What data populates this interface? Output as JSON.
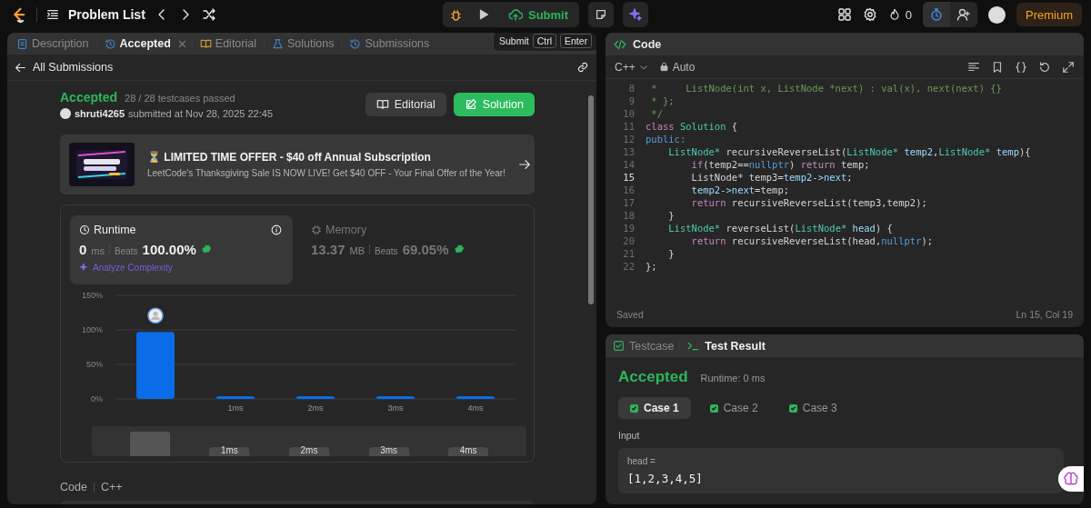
{
  "topbar": {
    "title": "Problem List",
    "submit": "Submit",
    "streak": "0",
    "premium": "Premium"
  },
  "tooltip": {
    "label": "Submit",
    "keys": [
      "Ctrl",
      "Enter"
    ]
  },
  "left_tabs": [
    {
      "label": "Description",
      "kind": "doc",
      "selected": false,
      "closable": false
    },
    {
      "label": "Accepted",
      "kind": "history",
      "selected": true,
      "closable": true
    },
    {
      "label": "Editorial",
      "kind": "book",
      "selected": false,
      "closable": false
    },
    {
      "label": "Solutions",
      "kind": "flask",
      "selected": false,
      "closable": false
    },
    {
      "label": "Submissions",
      "kind": "history",
      "selected": false,
      "closable": false
    }
  ],
  "back_link": "All Submissions",
  "submission": {
    "status": "Accepted",
    "testcases": "28 / 28 testcases passed",
    "user": "shruti4265",
    "submitted": "submitted at Nov 28, 2025 22:45",
    "editorial": "Editorial",
    "solution": "Solution"
  },
  "promo": {
    "kind": "picture",
    "title": "⏳ LIMITED TIME OFFER - $40 off Annual Subscription",
    "subtitle": "LeetCode's Thanksgiving Sale IS NOW LIVE! Get $40 OFF - Your Final Offer of the Year!"
  },
  "metrics": [
    {
      "label": "Runtime",
      "kind": "clock",
      "value": "0",
      "unit": "ms",
      "beats_label": "Beats",
      "beats": "100.00%",
      "selected": true
    },
    {
      "label": "Memory",
      "kind": "chip",
      "value": "13.37",
      "unit": "MB",
      "beats_label": "Beats",
      "beats": "69.05%",
      "selected": false
    }
  ],
  "analyze": "Analyze Complexity",
  "chart_data": {
    "type": "bar",
    "categories": [
      null,
      "1ms",
      "2ms",
      "3ms",
      "4ms"
    ],
    "values": [
      97,
      4,
      4,
      4,
      4
    ],
    "ylim": [
      0,
      150
    ],
    "yticks": [
      {
        "value": 0,
        "label": "0%"
      },
      {
        "value": 50,
        "label": "50%"
      },
      {
        "value": 100,
        "label": "100%"
      },
      {
        "value": 150,
        "label": "150%"
      }
    ]
  },
  "overview_labels": [
    "1ms",
    "2ms",
    "3ms",
    "4ms"
  ],
  "code_section": {
    "label": "Code",
    "language": "C++"
  },
  "editor": {
    "title": "Code",
    "language": "C++",
    "mode": "Auto",
    "status": "Saved",
    "cursor": "Ln 15, Col 19",
    "lines": [
      {
        "number": "8",
        "active": false,
        "segments": [
          {
            "kind": "comment",
            "text": " *     ListNode(int x, ListNode *next) : val(x), next(next) {}"
          }
        ]
      },
      {
        "number": "9",
        "active": false,
        "segments": [
          {
            "kind": "comment",
            "text": " * };"
          }
        ]
      },
      {
        "number": "10",
        "active": false,
        "segments": [
          {
            "kind": "comment",
            "text": " */"
          }
        ]
      },
      {
        "number": "11",
        "active": false,
        "segments": [
          {
            "kind": "keyword",
            "text": "class"
          },
          {
            "kind": "type",
            "text": " Solution"
          },
          {
            "kind": "plain",
            "text": " {"
          }
        ]
      },
      {
        "number": "12",
        "active": false,
        "segments": [
          {
            "kind": "constant",
            "text": "public:"
          }
        ]
      },
      {
        "number": "13",
        "active": false,
        "segments": [
          {
            "kind": "type",
            "text": "    ListNode*"
          },
          {
            "kind": "plain",
            "text": " recursiveReverseList("
          },
          {
            "kind": "type",
            "text": "ListNode*"
          },
          {
            "kind": "variable",
            "text": " temp2"
          },
          {
            "kind": "plain",
            "text": ","
          },
          {
            "kind": "type",
            "text": "ListNode*"
          },
          {
            "kind": "variable",
            "text": " temp"
          },
          {
            "kind": "plain",
            "text": "){"
          }
        ]
      },
      {
        "number": "14",
        "active": false,
        "segments": [
          {
            "kind": "keyword",
            "text": "        if"
          },
          {
            "kind": "plain",
            "text": "(temp2=="
          },
          {
            "kind": "constant",
            "text": "nullptr"
          },
          {
            "kind": "plain",
            "text": ") "
          },
          {
            "kind": "keyword",
            "text": "return"
          },
          {
            "kind": "plain",
            "text": " temp;"
          }
        ]
      },
      {
        "number": "15",
        "active": true,
        "segments": [
          {
            "kind": "plain",
            "text": "        ListNode* temp3="
          },
          {
            "kind": "variable",
            "text": "temp2->next"
          },
          {
            "kind": "plain",
            "text": ";"
          }
        ]
      },
      {
        "number": "16",
        "active": false,
        "segments": [
          {
            "kind": "variable",
            "text": "        temp2->next"
          },
          {
            "kind": "plain",
            "text": "=temp;"
          }
        ]
      },
      {
        "number": "17",
        "active": false,
        "segments": [
          {
            "kind": "keyword",
            "text": "        return"
          },
          {
            "kind": "plain",
            "text": " recursiveReverseList(temp3,temp2);"
          }
        ]
      },
      {
        "number": "18",
        "active": false,
        "segments": [
          {
            "kind": "plain",
            "text": "    }"
          }
        ]
      },
      {
        "number": "19",
        "active": false,
        "segments": [
          {
            "kind": "type",
            "text": "    ListNode*"
          },
          {
            "kind": "plain",
            "text": " reverseList("
          },
          {
            "kind": "type",
            "text": "ListNode*"
          },
          {
            "kind": "variable",
            "text": " head"
          },
          {
            "kind": "plain",
            "text": ") {"
          }
        ]
      },
      {
        "number": "20",
        "active": false,
        "segments": [
          {
            "kind": "keyword",
            "text": "        return"
          },
          {
            "kind": "plain",
            "text": " recursiveReverseList(head,"
          },
          {
            "kind": "constant",
            "text": "nullptr"
          },
          {
            "kind": "plain",
            "text": ");"
          }
        ]
      },
      {
        "number": "21",
        "active": false,
        "segments": [
          {
            "kind": "plain",
            "text": "    }"
          }
        ]
      },
      {
        "number": "22",
        "active": false,
        "segments": [
          {
            "kind": "plain",
            "text": "};"
          }
        ]
      }
    ]
  },
  "test_tabs": [
    {
      "label": "Testcase",
      "kind": "check",
      "selected": false
    },
    {
      "label": "Test Result",
      "kind": "terminal",
      "selected": true
    }
  ],
  "result": {
    "status": "Accepted",
    "runtime": "Runtime: 0 ms",
    "input_label": "Input",
    "param": "head =",
    "value": "[1,2,3,4,5]",
    "cases": [
      {
        "label": "Case 1",
        "selected": true,
        "passed": true
      },
      {
        "label": "Case 2",
        "selected": false,
        "passed": true
      },
      {
        "label": "Case 3",
        "selected": false,
        "passed": true
      }
    ]
  }
}
